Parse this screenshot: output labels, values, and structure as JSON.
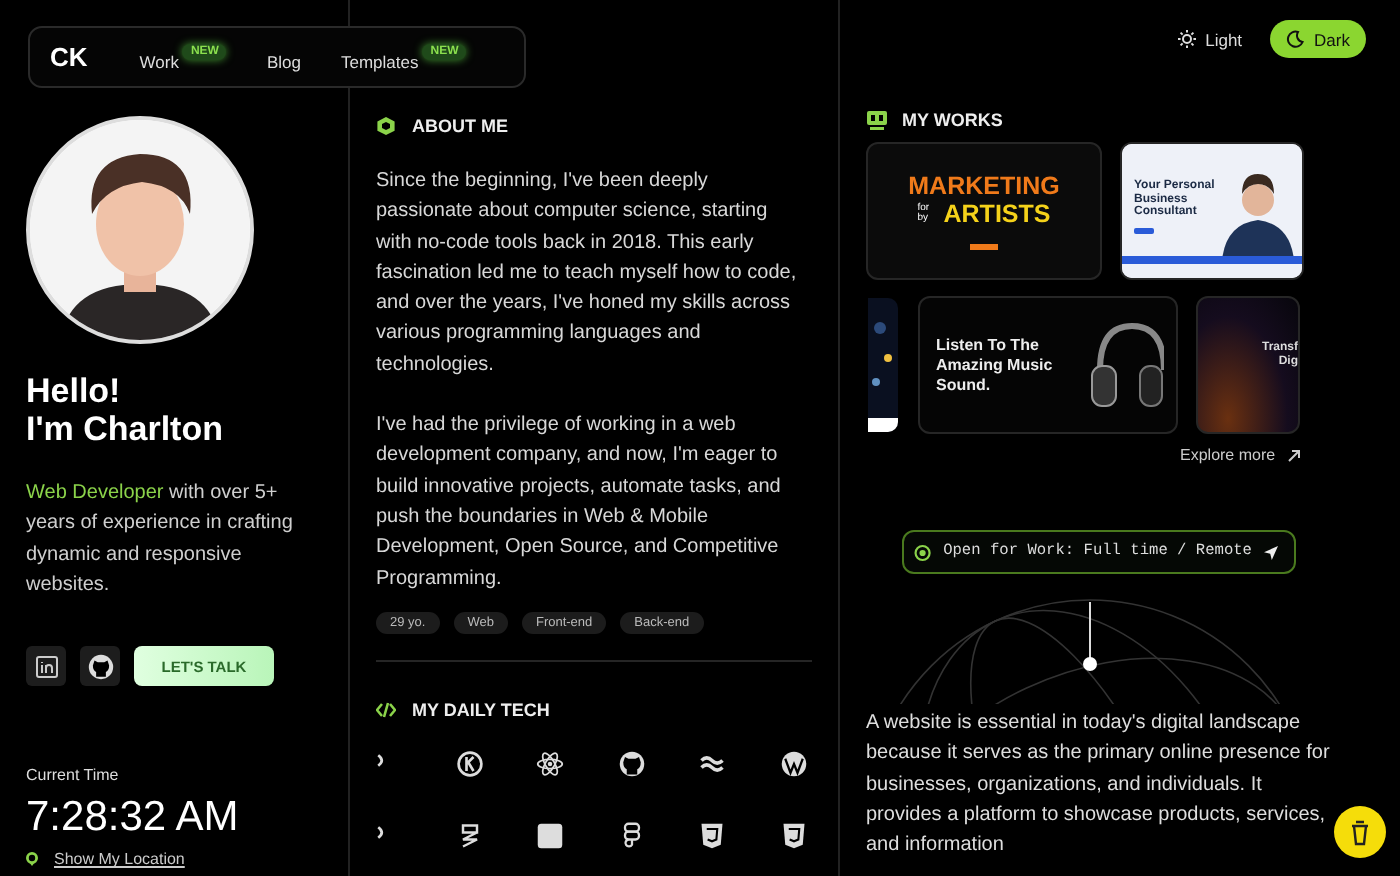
{
  "nav": {
    "logo": "CK",
    "items": [
      {
        "label": "Work",
        "badge": "NEW"
      },
      {
        "label": "Blog"
      },
      {
        "label": "Templates",
        "badge": "NEW"
      }
    ]
  },
  "theme_toggle": [
    {
      "label": "Light",
      "kind": "sun",
      "selected": false
    },
    {
      "label": "Dark",
      "kind": "moon",
      "selected": true
    }
  ],
  "profile": {
    "greeting": "Hello!",
    "name": "I'm Charlton",
    "bio": "*Web Developer* with over 5+ years of experience in crafting dynamic and responsive websites.",
    "socials": [
      {
        "kind": "linkedin"
      },
      {
        "kind": "github"
      }
    ],
    "cta": "LET'S TALK"
  },
  "clock": {
    "label": "Current Time",
    "time": "7:28:32 AM",
    "location_link": "Show My Location"
  },
  "about": {
    "title": "ABOUT ME",
    "paragraphs": [
      "Since the beginning, I've been deeply passionate about computer science, starting with no-code tools back in 2018. This early fascination led me to teach myself how to code, and over the years, I've honed my skills across various programming languages and technologies.",
      "I've had the privilege of working in a web development company, and now, I'm eager to build innovative projects, automate tasks, and push the boundaries in Web & Mobile Development, Open Source, and Competitive Programming."
    ],
    "tags": [
      "29 yo.",
      "Web",
      "Front-end",
      "Back-end"
    ]
  },
  "daily_tech": {
    "title": "MY DAILY TECH",
    "icons": [
      {
        "kind": "edge"
      },
      {
        "kind": "ring"
      },
      {
        "kind": "atom"
      },
      {
        "kind": "cat"
      },
      {
        "kind": "wave"
      },
      {
        "kind": "globe"
      },
      {
        "kind": "edge"
      },
      {
        "kind": "zigzag"
      },
      {
        "kind": "square"
      },
      {
        "kind": "figma"
      },
      {
        "kind": "shield"
      },
      {
        "kind": "shield"
      }
    ]
  },
  "works": {
    "title": "MY WORKS",
    "projects": [
      {
        "kind": "marketing",
        "lines": [
          "MARKETING",
          "for by",
          "ARTISTS"
        ]
      },
      {
        "kind": "consultant",
        "lines": [
          "Your Personal Business Consultant"
        ]
      },
      {
        "kind": "picture"
      },
      {
        "kind": "music",
        "lines": [
          "Listen To The Amazing Music Sound."
        ]
      },
      {
        "kind": "transform",
        "lines": [
          "Transf",
          "Dig"
        ]
      }
    ],
    "explore": "Explore more"
  },
  "status": {
    "text": "Open for Work: Full time / Remote"
  },
  "description": "A website is essential in today's digital landscape because it serves as the primary online presence for businesses, organizations, and individuals. It provides a platform to showcase products, services, and information"
}
